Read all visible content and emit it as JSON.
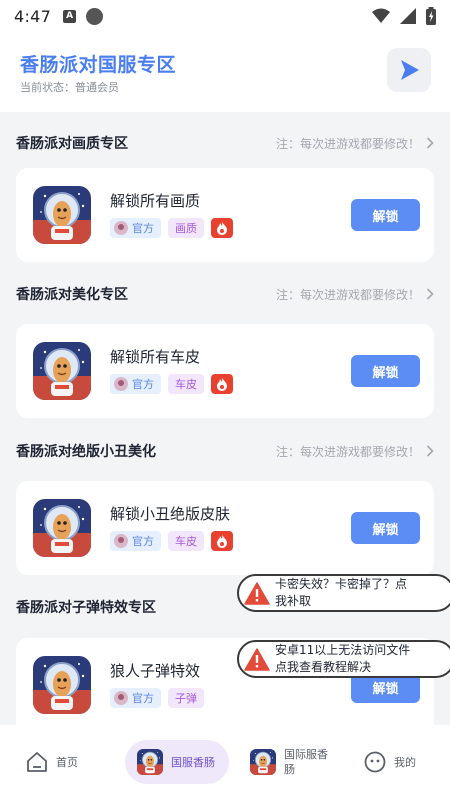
{
  "status_bar": {
    "time": "4:47",
    "input_badge": "A"
  },
  "header": {
    "title": "香肠派对国服专区",
    "subtitle": "当前状态：普通会员"
  },
  "sections": [
    {
      "title": "香肠派对画质专区",
      "note": "注：每次进游戏都要修改！",
      "item": {
        "name": "解锁所有画质",
        "official_tag": "官方",
        "category_tag": "画质",
        "hot": true,
        "button": "解锁"
      }
    },
    {
      "title": "香肠派对美化专区",
      "note": "注：每次进游戏都要修改！",
      "item": {
        "name": "解锁所有车皮",
        "official_tag": "官方",
        "category_tag": "车皮",
        "hot": true,
        "button": "解锁"
      }
    },
    {
      "title": "香肠派对绝版小丑美化",
      "note": "注：每次进游戏都要修改！",
      "item": {
        "name": "解锁小丑绝版皮肤",
        "official_tag": "官方",
        "category_tag": "车皮",
        "hot": true,
        "button": "解锁"
      }
    },
    {
      "title": "香肠派对子弹特效专区",
      "note": "",
      "item": {
        "name": "狼人子弹特效",
        "official_tag": "官方",
        "category_tag": "子弹",
        "hot": false,
        "button": "解锁"
      }
    }
  ],
  "toasts": [
    {
      "line1": "卡密失效？卡密掉了？点",
      "line2": "我补取"
    },
    {
      "line1": "安卓11以上无法访问文件",
      "line2": "点我查看教程解决"
    }
  ],
  "bottom_nav": [
    {
      "label": "首页",
      "icon": "home-icon",
      "active": false
    },
    {
      "label": "国服香肠",
      "icon": "game-thumbnail",
      "active": true
    },
    {
      "label_line1": "国际服香",
      "label_line2": "肠",
      "icon": "game-thumbnail",
      "active": false
    },
    {
      "label": "我的",
      "icon": "profile-face-icon",
      "active": false
    }
  ],
  "colors": {
    "accent": "#5b8df5",
    "title_blue": "#4a7ef0",
    "hot_red": "#e8412f",
    "tag_official_bg": "#e6effd",
    "tag_category_bg": "#f2e6fb",
    "page_bg": "#f3f4f6"
  }
}
